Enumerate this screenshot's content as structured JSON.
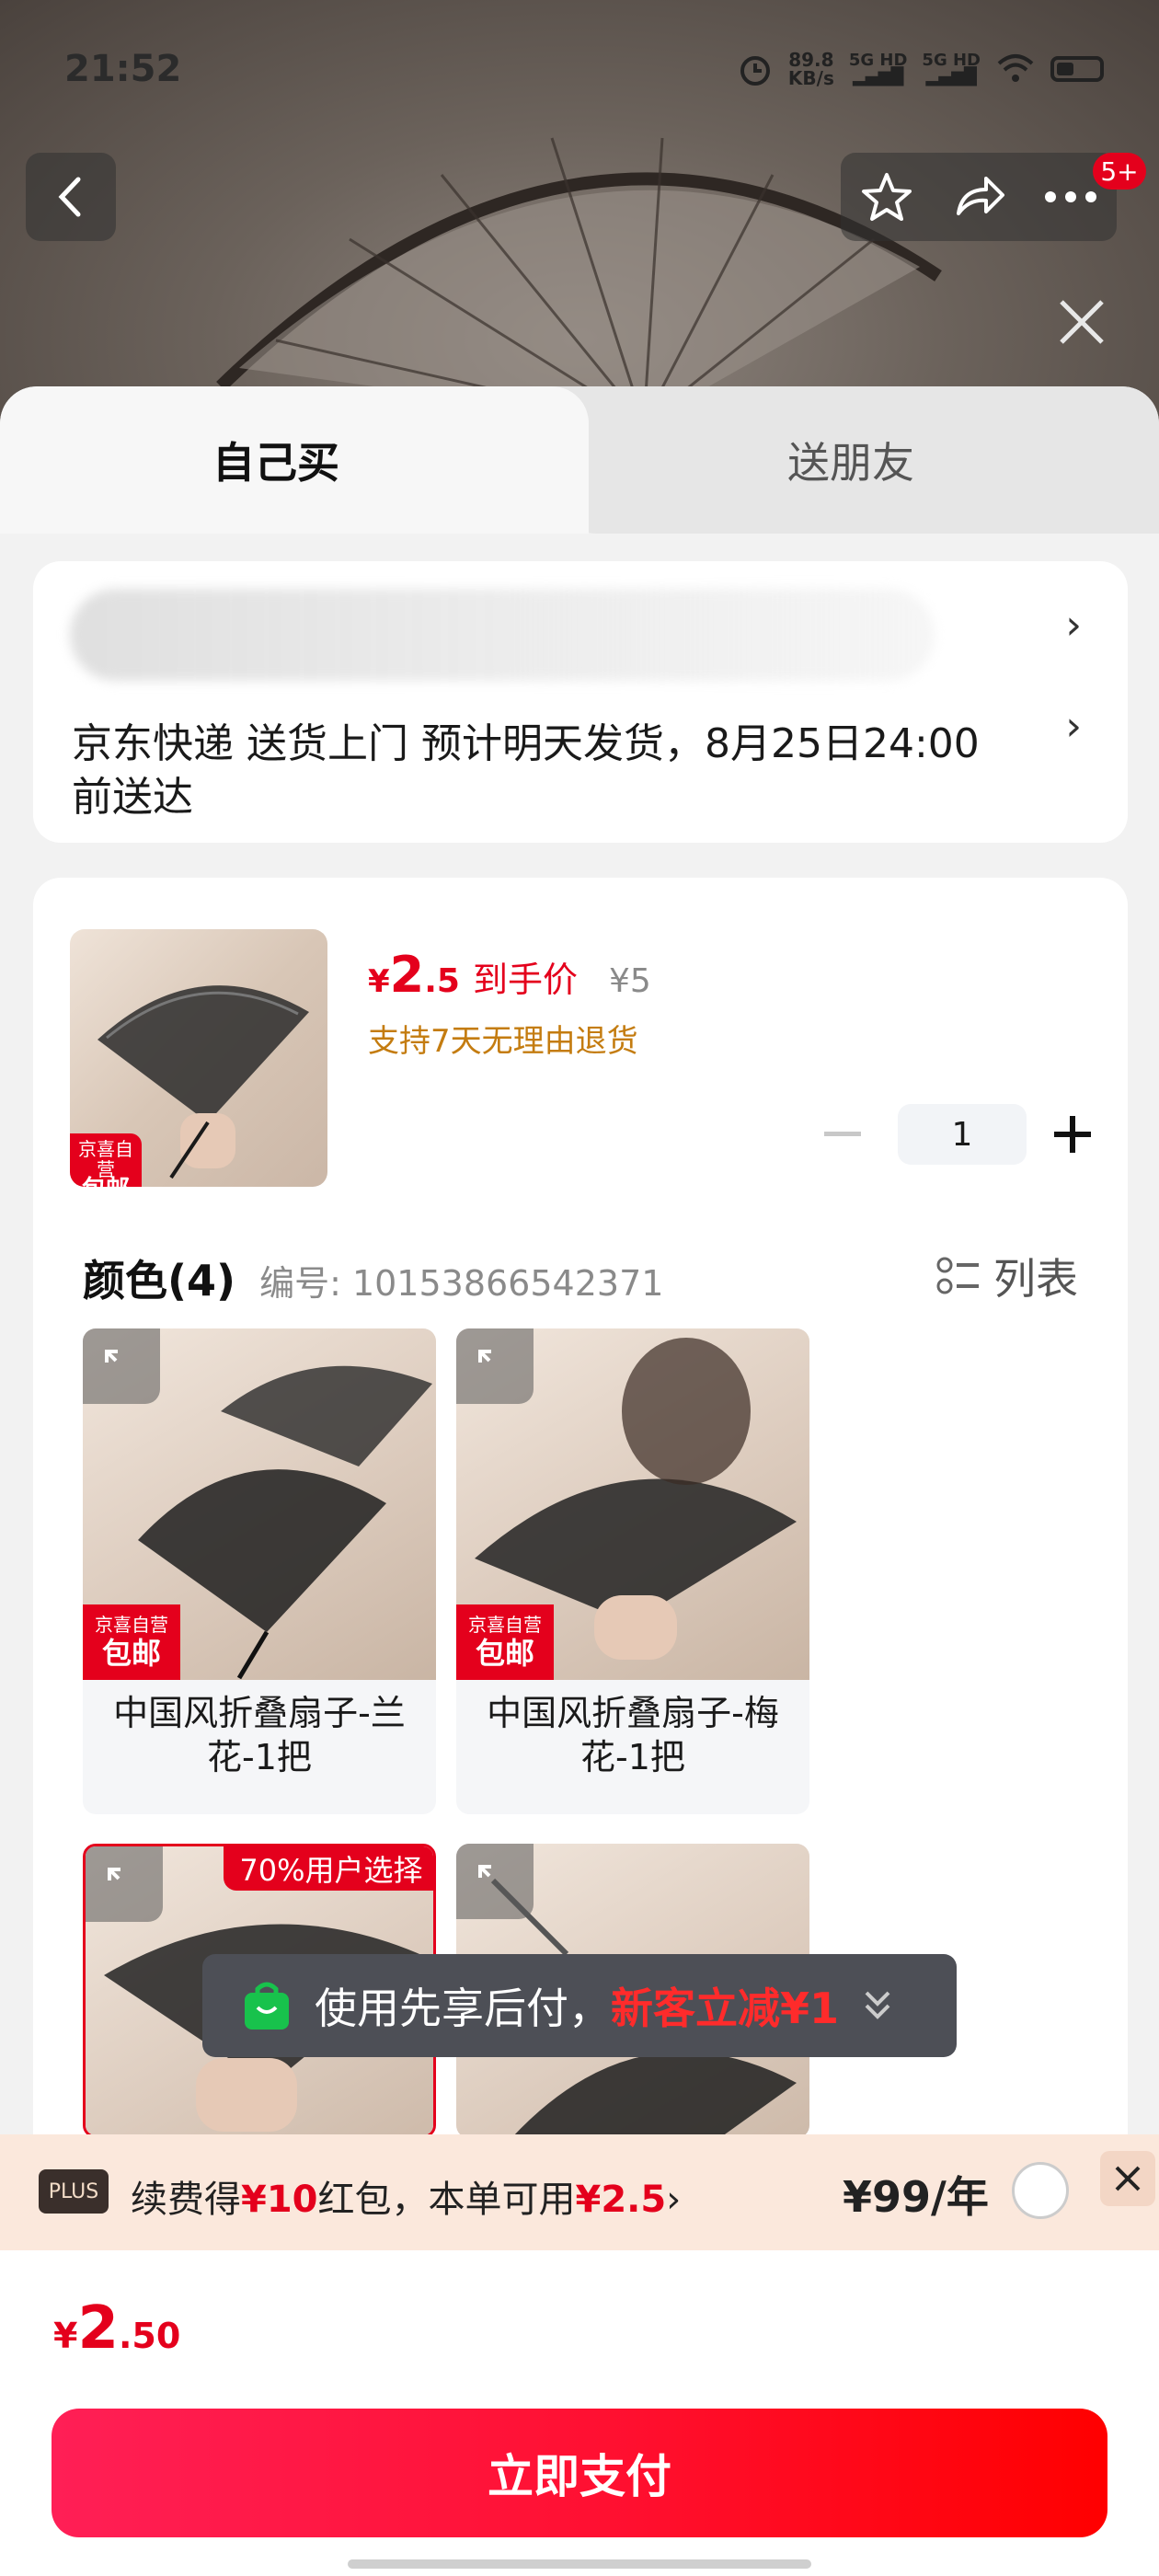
{
  "status_bar": {
    "time": "21:52",
    "net_speed": "89.8",
    "net_unit": "KB/s",
    "sim1": "5G HD",
    "sim2": "5G HD"
  },
  "top_actions": {
    "badge": "5+"
  },
  "tabs": {
    "self": "自己买",
    "gift": "送朋友"
  },
  "address": {
    "delivery": "京东快递 送货上门 预计明天发货，8月25日24:00前送达"
  },
  "product": {
    "price_symbol": "¥",
    "price_int": "2",
    "price_dec": ".5",
    "price_label": "到手价",
    "original_price": "¥5",
    "return_policy": "支持7天无理由退货",
    "quantity": "1",
    "thumb_tag_top": "京喜自营",
    "thumb_tag_bottom": "包邮"
  },
  "color_section": {
    "title": "颜色(4)",
    "code": "编号: 10153866542371",
    "list_label": "列表",
    "options": [
      {
        "label": "中国风折叠扇子-兰花-1把",
        "tag_top": "京喜自营",
        "tag_bottom": "包邮"
      },
      {
        "label": "中国风折叠扇子-梅花-1把",
        "tag_top": "京喜自营",
        "tag_bottom": "包邮"
      },
      {
        "label": "",
        "badge": "70%用户选择"
      },
      {
        "label": ""
      }
    ]
  },
  "toast": {
    "text_prefix": "使用先享后付，",
    "text_highlight": "新客立减¥1"
  },
  "plus_bar": {
    "tag": "PLUS",
    "text_a": "续费得",
    "text_b": "¥10",
    "text_c": "红包，本单可用",
    "text_d": "¥2.5",
    "arrow": "›",
    "price": "¥99/年"
  },
  "footer": {
    "total_symbol": "¥",
    "total_int": "2",
    "total_dec": ".50",
    "pay_label": "立即支付"
  },
  "colors": {
    "brand_red": "#e4001c",
    "orange_text": "#c47c10"
  }
}
